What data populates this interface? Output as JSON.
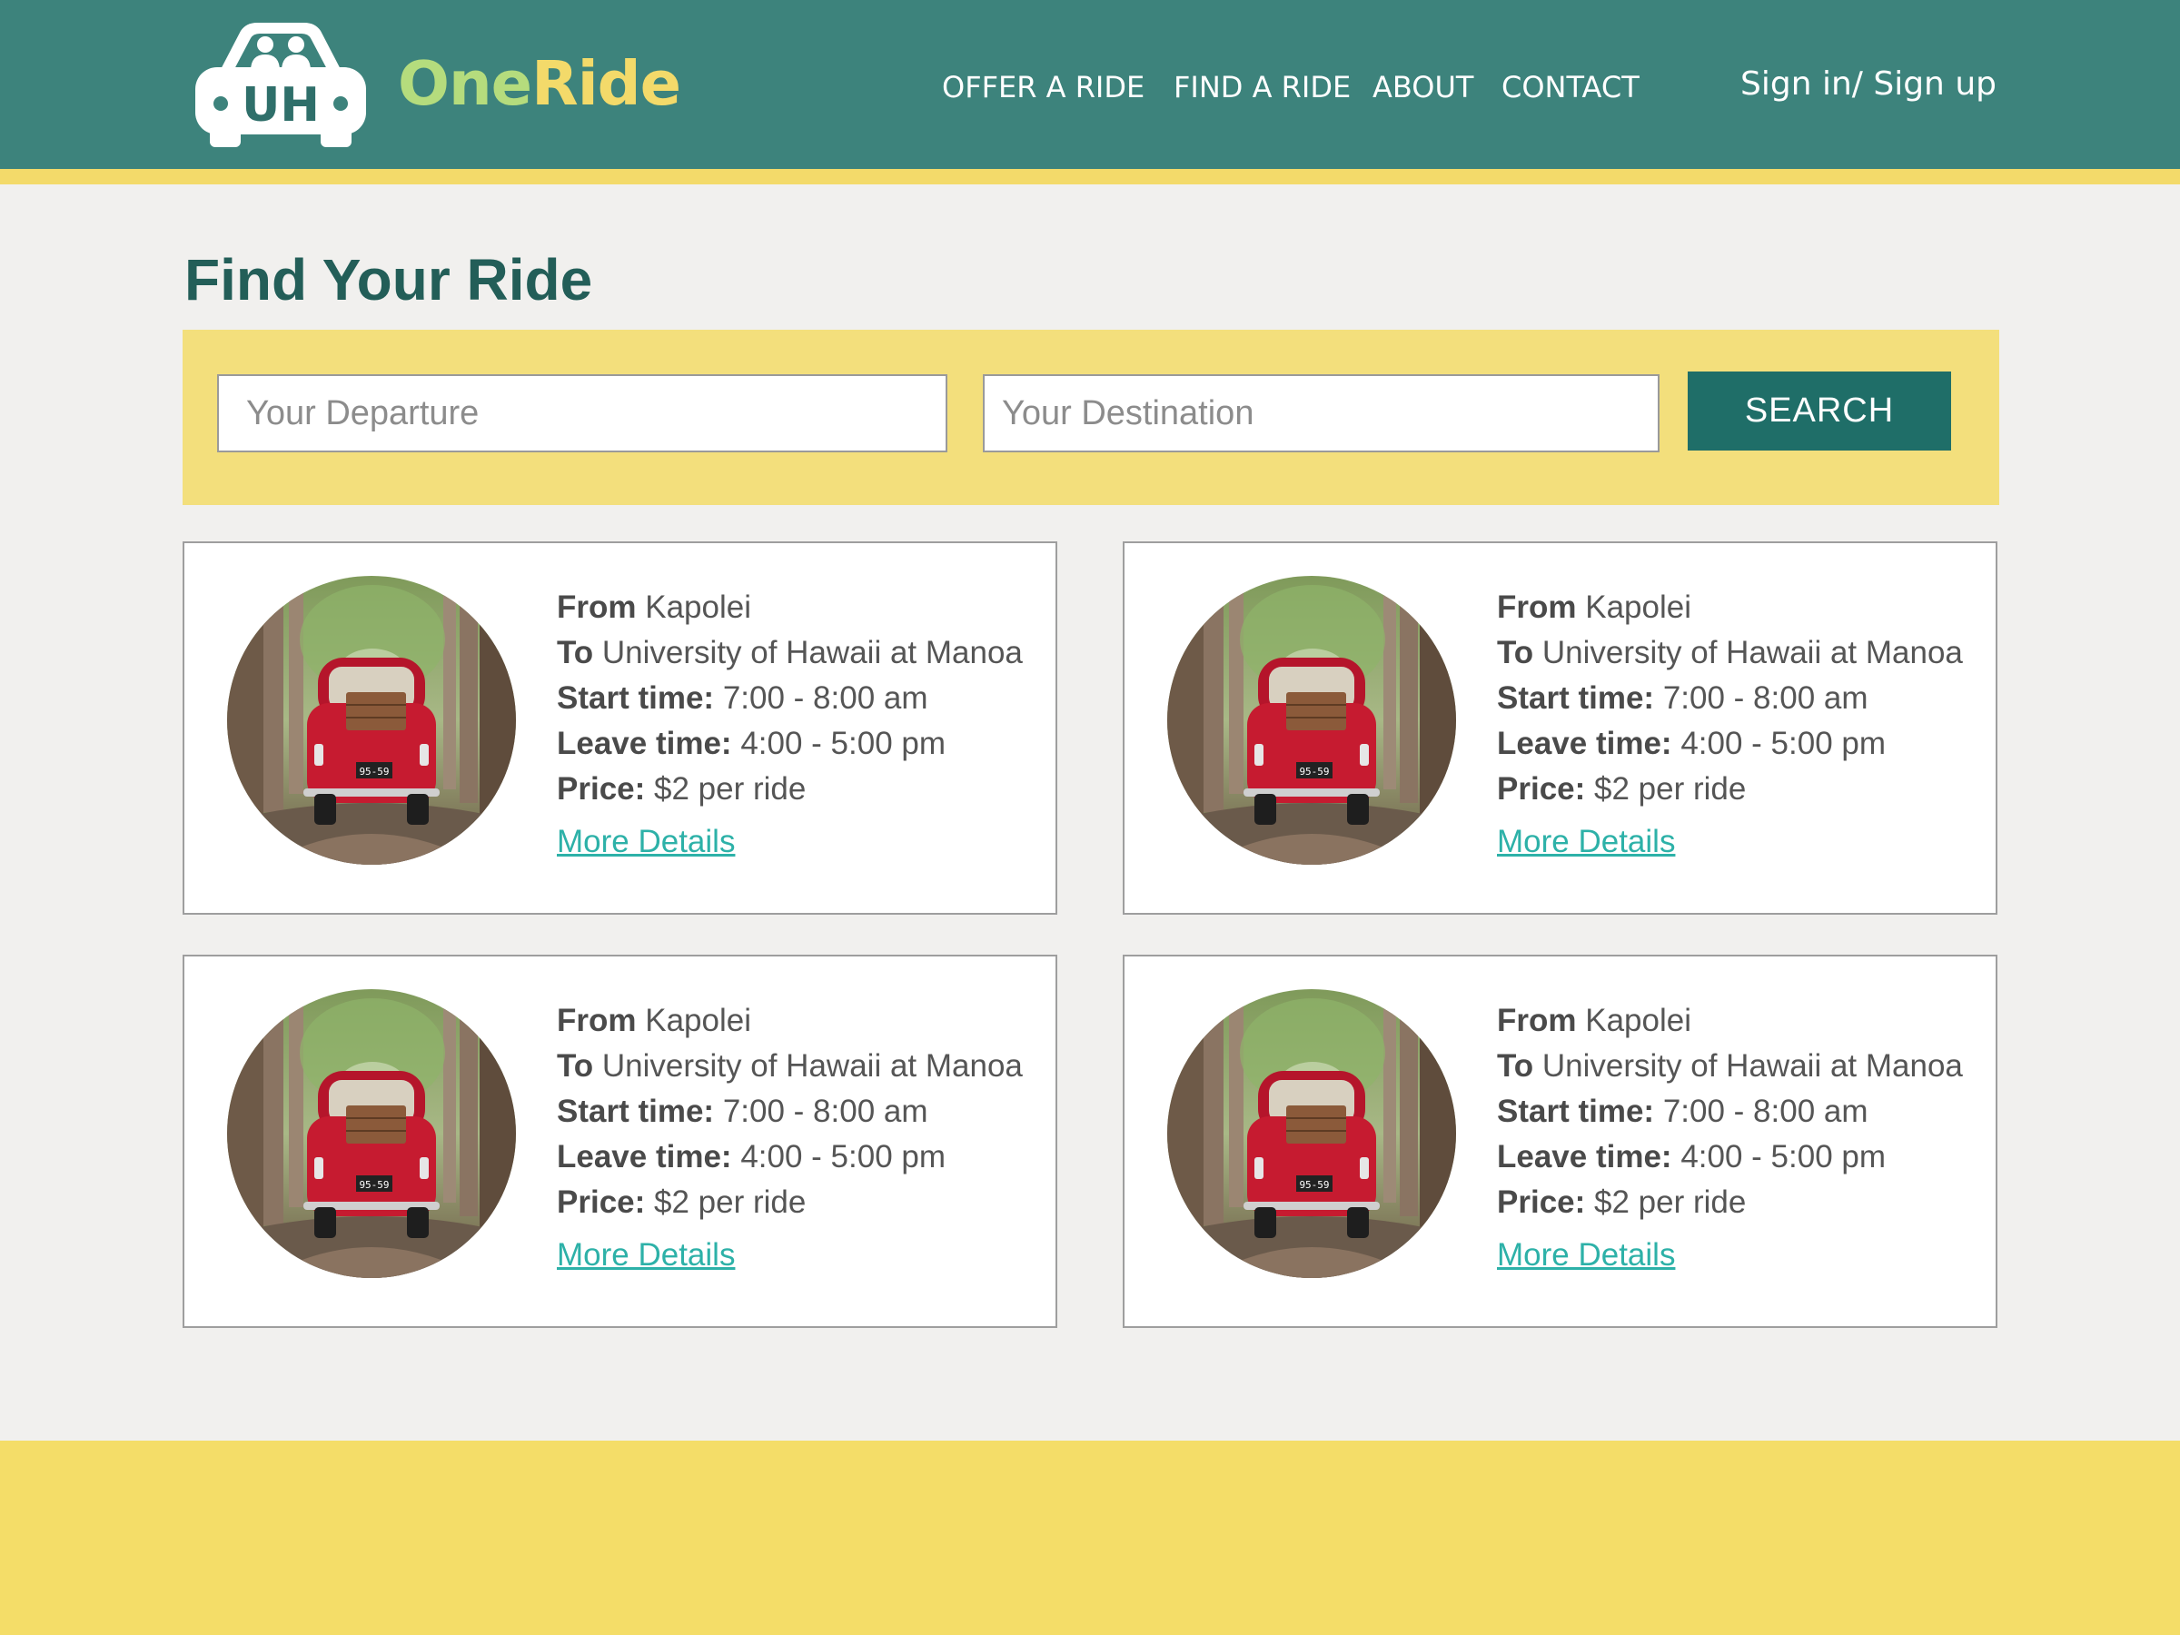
{
  "brand": {
    "logo_letters": "UH",
    "name_part1": "One",
    "name_part2": "Ride"
  },
  "nav": {
    "items": [
      {
        "label": "OFFER A RIDE"
      },
      {
        "label": "FIND A RIDE"
      },
      {
        "label": "ABOUT"
      },
      {
        "label": "CONTACT"
      }
    ],
    "signin_label": "Sign in/ Sign up"
  },
  "page": {
    "title": "Find Your Ride"
  },
  "search": {
    "departure_placeholder": "Your Departure",
    "destination_placeholder": "Your Destination",
    "button_label": "SEARCH"
  },
  "ride_field_labels": {
    "from": "From",
    "to": "To",
    "start": "Start time:",
    "leave": "Leave time:",
    "price": "Price:"
  },
  "rides": [
    {
      "from": "Kapolei",
      "to": "University of Hawaii at Manoa",
      "start": "7:00 - 8:00 am",
      "leave": "4:00 - 5:00 pm",
      "price": "$2 per ride",
      "link": "More Details",
      "plate": "95-59"
    },
    {
      "from": "Kapolei",
      "to": "University of Hawaii at Manoa",
      "start": "7:00 - 8:00 am",
      "leave": "4:00 - 5:00 pm",
      "price": "$2 per ride",
      "link": "More Details",
      "plate": "95-59"
    },
    {
      "from": "Kapolei",
      "to": "University of Hawaii at Manoa",
      "start": "7:00 - 8:00 am",
      "leave": "4:00 - 5:00 pm",
      "price": "$2 per ride",
      "link": "More Details",
      "plate": "95-59"
    },
    {
      "from": "Kapolei",
      "to": "University of Hawaii at Manoa",
      "start": "7:00 - 8:00 am",
      "leave": "4:00 - 5:00 pm",
      "price": "$2 per ride",
      "link": "More Details",
      "plate": "95-59"
    }
  ],
  "colors": {
    "header": "#3d837c",
    "accent_yellow": "#f3da6a",
    "search_button": "#1f6e68",
    "title": "#235e58",
    "link": "#2db1a8"
  },
  "icons": {
    "logo": "car-logo-icon",
    "ride_photo": "red-car-photo"
  }
}
